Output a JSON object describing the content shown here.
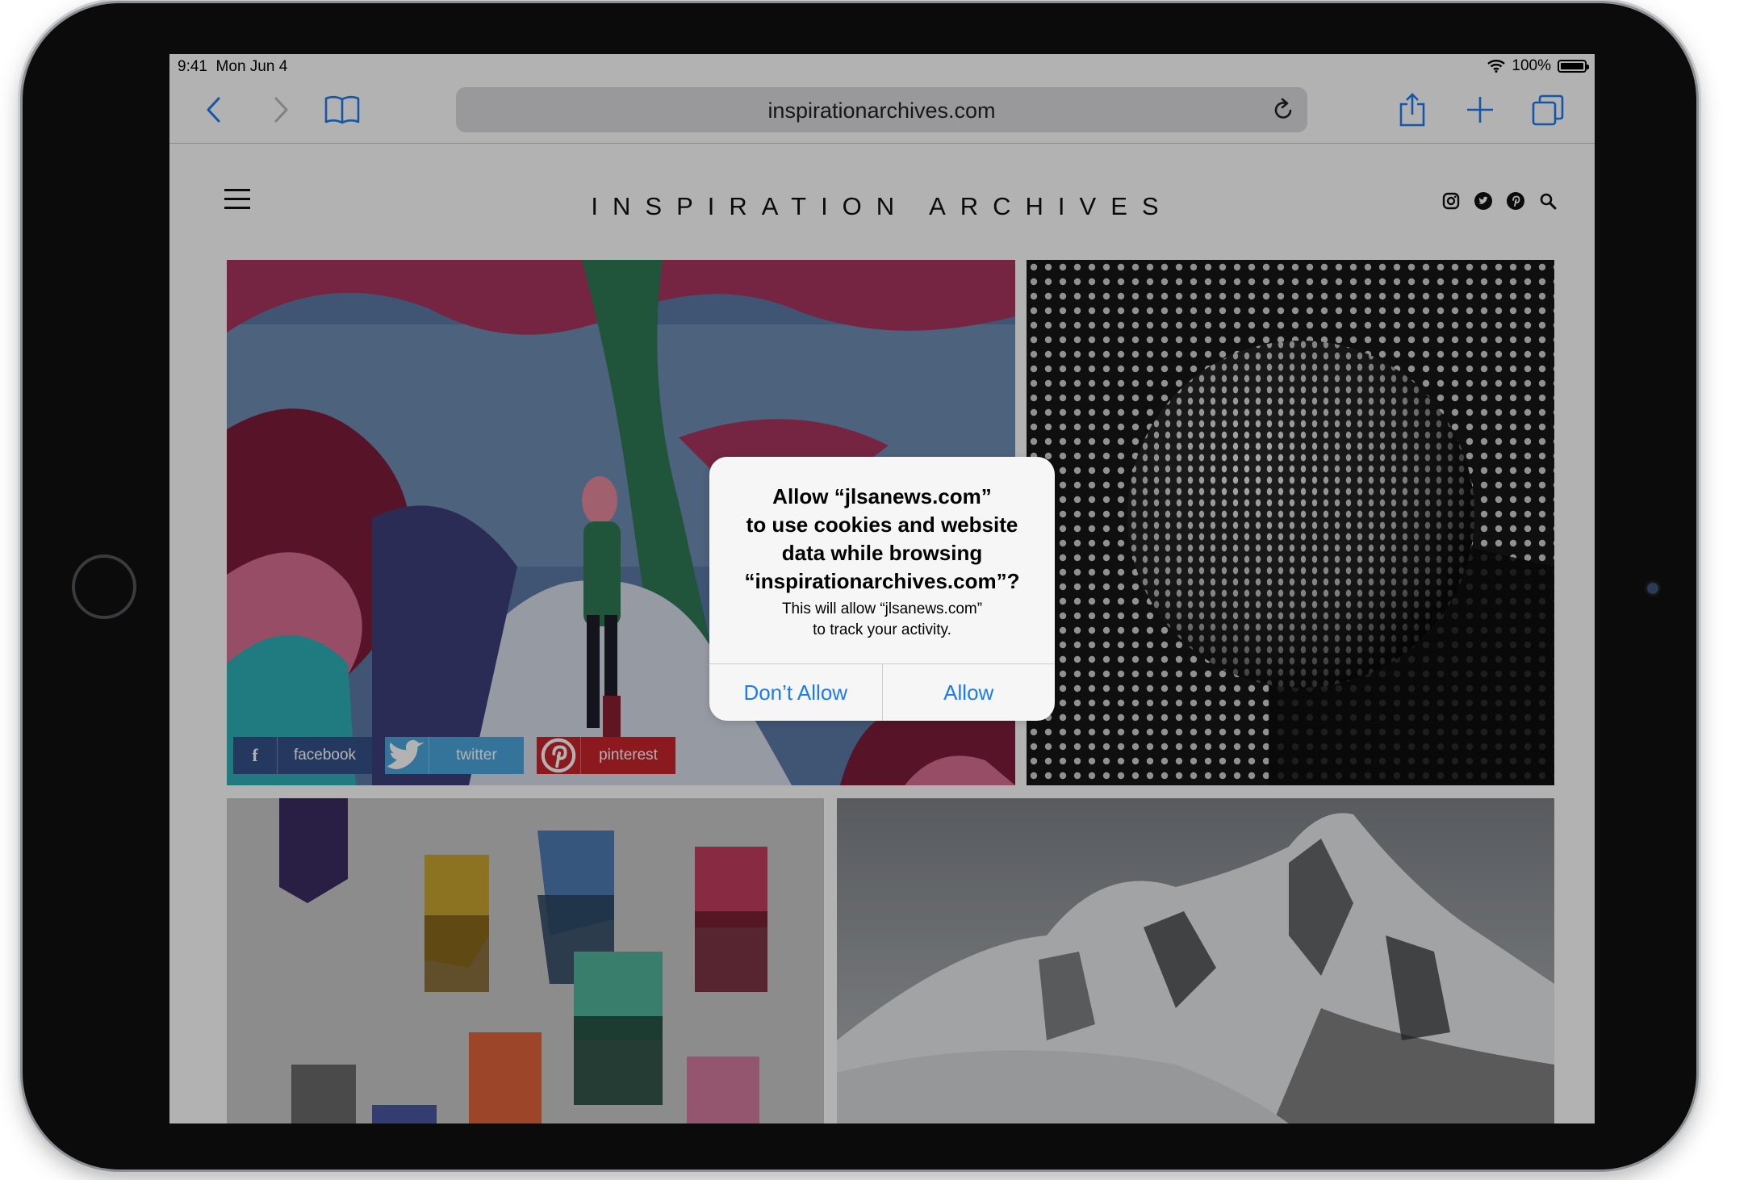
{
  "status_bar": {
    "time": "9:41",
    "date": "Mon Jun 4",
    "battery": "100%",
    "battery_level": 1.0
  },
  "browser": {
    "url": "inspirationarchives.com",
    "icons": [
      "back-chevron-icon",
      "forward-chevron-icon",
      "bookmarks-book-icon",
      "reload-icon",
      "share-icon",
      "new-tab-plus-icon",
      "tabs-icon"
    ]
  },
  "site": {
    "title": "INSPIRATION ARCHIVES",
    "social_icons": [
      "instagram-icon",
      "twitter-icon",
      "pinterest-icon",
      "search-icon"
    ],
    "share_buttons": [
      {
        "label": "facebook",
        "icon": "f",
        "color": "#36518a"
      },
      {
        "label": "twitter",
        "icon": "twitter-bird-icon",
        "color": "#4ba6df"
      },
      {
        "label": "pinterest",
        "icon": "pinterest-icon",
        "color": "#c9242b"
      }
    ]
  },
  "alert": {
    "title_lines": [
      "Allow “jlsanews.com”",
      "to use cookies and website",
      "data while browsing",
      "“inspirationarchives.com”?"
    ],
    "message_lines": [
      "This will allow “jlsanews.com”",
      "to track your activity."
    ],
    "buttons": [
      "Don’t Allow",
      "Allow"
    ],
    "button_color": "#1d7bf0"
  }
}
